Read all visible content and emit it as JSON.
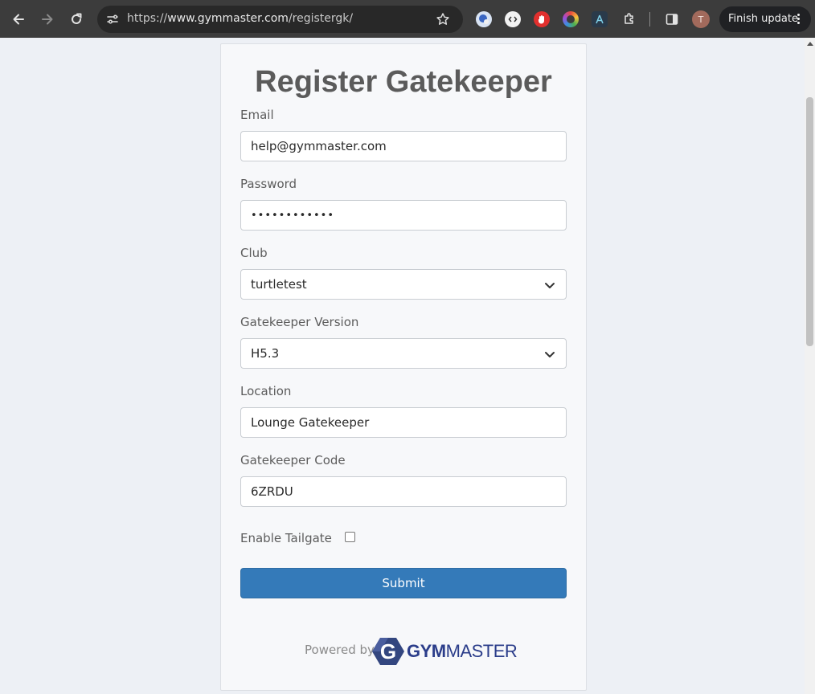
{
  "browser": {
    "url_prefix": "https://",
    "url_host": "www.gymmaster.com",
    "url_path": "/registergk/",
    "profile_initial": "T",
    "finish_update_label": "Finish update",
    "icons": [
      "back-icon",
      "forward-icon",
      "reload-icon",
      "site-info-icon",
      "star-icon",
      "extensions-icon",
      "side-panel-icon",
      "more-icon"
    ]
  },
  "form": {
    "title": "Register Gatekeeper",
    "email_label": "Email",
    "email_value": "help@gymmaster.com",
    "password_label": "Password",
    "password_value": "••••••••••••",
    "club_label": "Club",
    "club_value": "turtletest",
    "version_label": "Gatekeeper Version",
    "version_value": "H5.3",
    "location_label": "Location",
    "location_value": "Lounge Gatekeeper",
    "code_label": "Gatekeeper Code",
    "code_value": "6ZRDU",
    "tailgate_label": "Enable Tailgate",
    "tailgate_checked": false,
    "submit_label": "Submit"
  },
  "footer": {
    "powered_by": "Powered by",
    "logo_gym": "GYM",
    "logo_master": "MASTER",
    "logo_letter": "G"
  },
  "colors": {
    "primary_button": "#347ab9",
    "brand": "#2b3d8a",
    "toolbar": "#3c3c3c"
  }
}
